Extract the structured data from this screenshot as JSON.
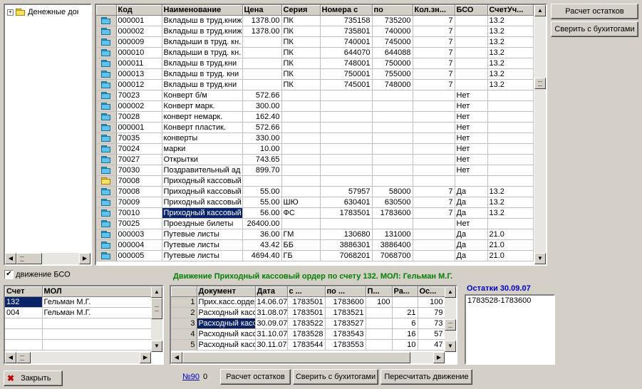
{
  "tree": {
    "items": [
      {
        "label": "Денежные документы",
        "expander": "+"
      }
    ]
  },
  "main_grid": {
    "columns": [
      "",
      "Код",
      "Наименование",
      "Цена",
      "Серия",
      "Номера с",
      "по",
      "Кол.зн...",
      "БСО",
      "СчетУч..."
    ],
    "rows": [
      {
        "folder": "blue",
        "code": "000001",
        "name": "Вкладыш в труд.книж",
        "price": "1378.00",
        "series": "ПК",
        "from": "735158",
        "to": "735200",
        "qty": "7",
        "bso": "",
        "acc": "13.2"
      },
      {
        "folder": "blue",
        "code": "000002",
        "name": "Вкладыш в труд.книж",
        "price": "1378.00",
        "series": "ПК",
        "from": "735801",
        "to": "740000",
        "qty": "7",
        "bso": "",
        "acc": "13.2"
      },
      {
        "folder": "blue",
        "code": "000009",
        "name": "Вкладыши в труд. кн.",
        "price": "",
        "series": "ПК",
        "from": "740001",
        "to": "745000",
        "qty": "7",
        "bso": "",
        "acc": "13.2"
      },
      {
        "folder": "blue",
        "code": "000010",
        "name": "Вкладыши в труд. кн.",
        "price": "",
        "series": "ПК",
        "from": "644070",
        "to": "644088",
        "qty": "7",
        "bso": "",
        "acc": "13.2"
      },
      {
        "folder": "blue",
        "code": "000011",
        "name": "Вкладыш в труд.кни",
        "price": "",
        "series": "ПК",
        "from": "748001",
        "to": "750000",
        "qty": "7",
        "bso": "",
        "acc": "13.2"
      },
      {
        "folder": "blue",
        "code": "000013",
        "name": "Вкладыш в труд. кни",
        "price": "",
        "series": "ПК",
        "from": "750001",
        "to": "755000",
        "qty": "7",
        "bso": "",
        "acc": "13.2"
      },
      {
        "folder": "blue",
        "code": "000012",
        "name": "Вкладыш в труд.кни",
        "price": "",
        "series": "ПК",
        "from": "745001",
        "to": "748000",
        "qty": "7",
        "bso": "",
        "acc": "13.2"
      },
      {
        "folder": "blue",
        "code": "70023",
        "name": "Конверт б/м",
        "price": "572.66",
        "series": "",
        "from": "",
        "to": "",
        "qty": "",
        "bso": "Нет",
        "acc": ""
      },
      {
        "folder": "blue",
        "code": "000002",
        "name": "Конверт марк.",
        "price": "300.00",
        "series": "",
        "from": "",
        "to": "",
        "qty": "",
        "bso": "Нет",
        "acc": ""
      },
      {
        "folder": "blue",
        "code": "70028",
        "name": "конверт немарк.",
        "price": "162.40",
        "series": "",
        "from": "",
        "to": "",
        "qty": "",
        "bso": "Нет",
        "acc": ""
      },
      {
        "folder": "blue",
        "code": "000001",
        "name": "Конверт пластик.",
        "price": "572.66",
        "series": "",
        "from": "",
        "to": "",
        "qty": "",
        "bso": "Нет",
        "acc": ""
      },
      {
        "folder": "blue",
        "code": "70035",
        "name": "конверты",
        "price": "330.00",
        "series": "",
        "from": "",
        "to": "",
        "qty": "",
        "bso": "Нет",
        "acc": ""
      },
      {
        "folder": "blue",
        "code": "70024",
        "name": "марки",
        "price": "10.00",
        "series": "",
        "from": "",
        "to": "",
        "qty": "",
        "bso": "Нет",
        "acc": ""
      },
      {
        "folder": "blue",
        "code": "70027",
        "name": "Открытки",
        "price": "743.65",
        "series": "",
        "from": "",
        "to": "",
        "qty": "",
        "bso": "Нет",
        "acc": ""
      },
      {
        "folder": "blue",
        "code": "70030",
        "name": "Поздравительный ад",
        "price": "899.70",
        "series": "",
        "from": "",
        "to": "",
        "qty": "",
        "bso": "Нет",
        "acc": ""
      },
      {
        "folder": "yellow",
        "code": "70008",
        "name": "Приходный кассовый",
        "price": "",
        "series": "",
        "from": "",
        "to": "",
        "qty": "",
        "bso": "",
        "acc": ""
      },
      {
        "folder": "blue",
        "code": "70008",
        "name": "Приходный кассовый",
        "price": "55.00",
        "series": "",
        "from": "57957",
        "to": "58000",
        "qty": "7",
        "bso": "Да",
        "acc": "13.2"
      },
      {
        "folder": "blue",
        "code": "70009",
        "name": "Приходный кассовый",
        "price": "55.00",
        "series": "ШЮ",
        "from": "630401",
        "to": "630500",
        "qty": "7",
        "bso": "Да",
        "acc": "13.2"
      },
      {
        "folder": "blue",
        "code": "70010",
        "name": "Приходный кассовый",
        "price": "56.00",
        "series": "ФС",
        "from": "1783501",
        "to": "1783600",
        "qty": "7",
        "bso": "Да",
        "acc": "13.2",
        "selected": true
      },
      {
        "folder": "blue",
        "code": "70025",
        "name": "Проездные билеты",
        "price": "26400.00",
        "series": "",
        "from": "",
        "to": "",
        "qty": "",
        "bso": "Нет",
        "acc": ""
      },
      {
        "folder": "blue",
        "code": "000003",
        "name": "Путевые листы",
        "price": "36.00",
        "series": "ГМ",
        "from": "130680",
        "to": "131000",
        "qty": "",
        "bso": "Да",
        "acc": "21.0"
      },
      {
        "folder": "blue",
        "code": "000004",
        "name": "Путевые листы",
        "price": "43.42",
        "series": "ББ",
        "from": "3886301",
        "to": "3886400",
        "qty": "",
        "bso": "Да",
        "acc": "21.0"
      },
      {
        "folder": "blue",
        "code": "000005",
        "name": "Путевые листы",
        "price": "4694.40",
        "series": "ГБ",
        "from": "7068201",
        "to": "7068700",
        "qty": "",
        "bso": "Да",
        "acc": "21.0"
      }
    ]
  },
  "buttons": {
    "calc_balance": "Расчет остатков",
    "reconcile": "Сверить с бухитогами",
    "close": "Закрыть",
    "calc_balance2": "Расчет остатков",
    "reconcile2": "Сверить с бухитогами",
    "recalc_movement": "Пересчитать движение"
  },
  "bso_movement": {
    "checkbox_label": "движение БСО",
    "checked": true
  },
  "movement_title": "Движение Приходный кассовый ордер по счету 132. МОЛ: Гельман М.Г.",
  "account_grid": {
    "columns": [
      "Счет",
      "МОЛ"
    ],
    "rows": [
      {
        "account": "132",
        "mol": "Гельман М.Г.",
        "selected": true
      },
      {
        "account": "004",
        "mol": "Гельман М.Г."
      }
    ],
    "empty_rows": 3
  },
  "doc_grid": {
    "columns": [
      "",
      "Документ",
      "Дата",
      "с ...",
      "по ...",
      "П...",
      "Ра...",
      "Ос..."
    ],
    "rows": [
      {
        "n": "1",
        "doc": "Прих.касс.ордер",
        "date": "14.06.07",
        "from": "1783501",
        "to": "1783600",
        "p": "100",
        "r": "",
        "o": "100"
      },
      {
        "n": "2",
        "doc": "Расходный касс",
        "date": "31.08.07",
        "from": "1783501",
        "to": "1783521",
        "p": "",
        "r": "21",
        "o": "79"
      },
      {
        "n": "3",
        "doc": "Расходный касс",
        "date": "30.09.07",
        "from": "1783522",
        "to": "1783527",
        "p": "",
        "r": "6",
        "o": "73",
        "selected": true
      },
      {
        "n": "4",
        "doc": "Расходный касс",
        "date": "31.10.07",
        "from": "1783528",
        "to": "1783543",
        "p": "",
        "r": "16",
        "o": "57"
      },
      {
        "n": "5",
        "doc": "Расходный касс",
        "date": "30.11.07",
        "from": "1783544",
        "to": "1783553",
        "p": "",
        "r": "10",
        "o": "47"
      }
    ]
  },
  "balances": {
    "title": "Остатки 30.09.07",
    "items": [
      "1783528-1783600"
    ]
  },
  "footer": {
    "link": "№90",
    "counter": "0"
  },
  "colors": {
    "title_green": "#008000",
    "balance_blue": "#0000c0",
    "selection": "#0a246a"
  }
}
